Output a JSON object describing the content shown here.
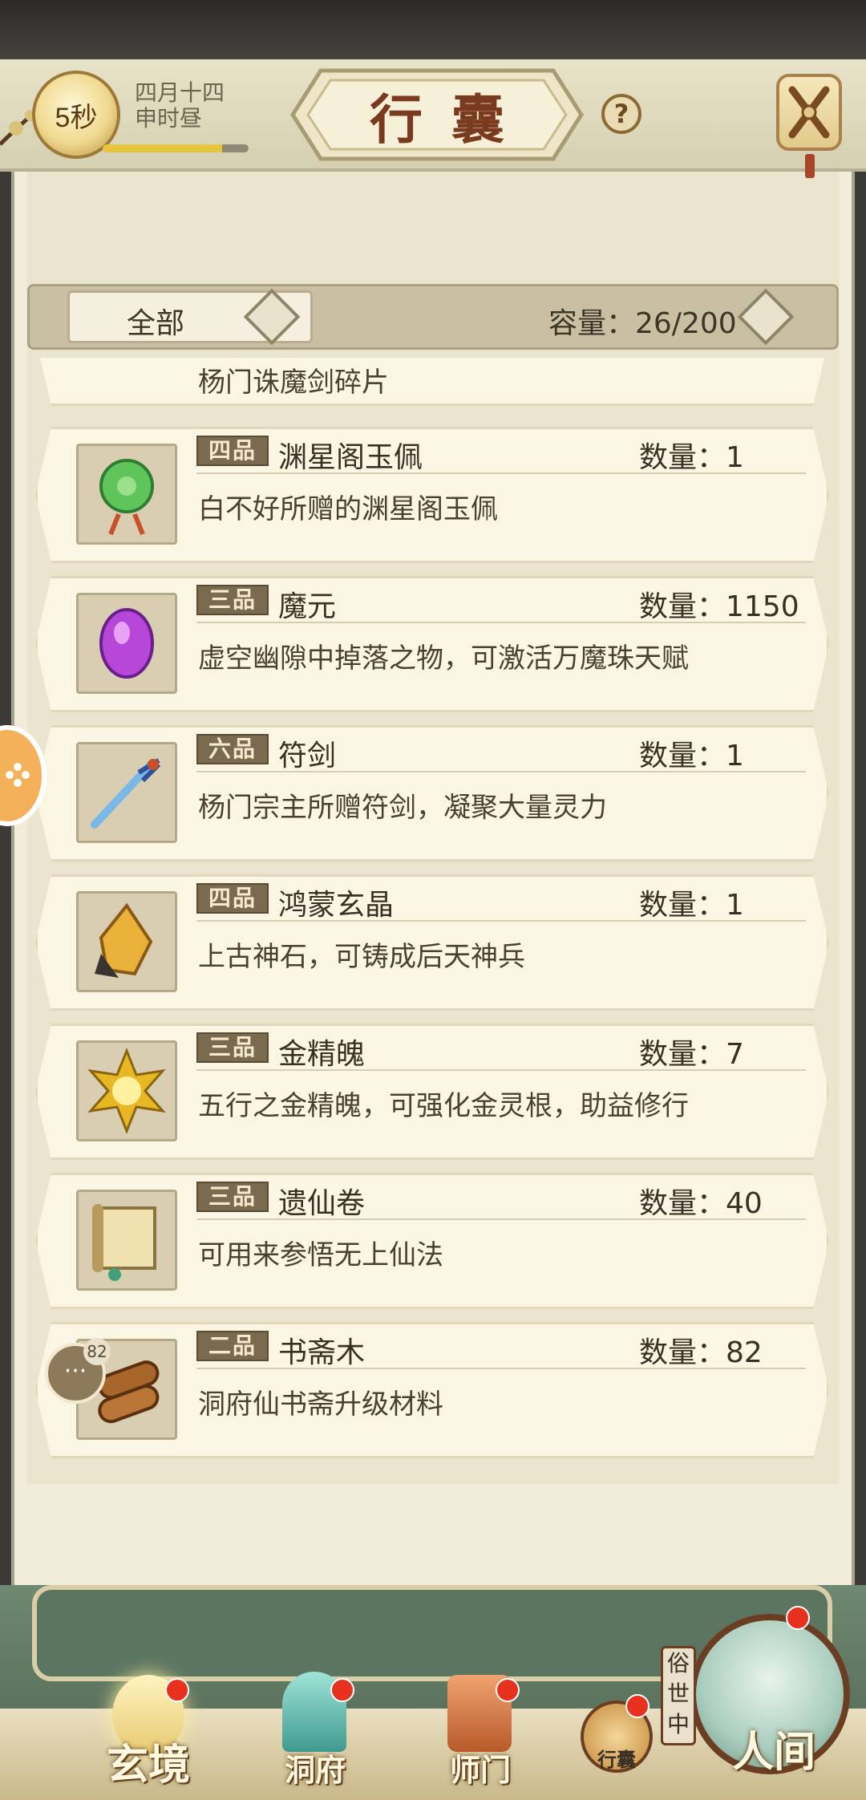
{
  "header": {
    "timer": "5秒",
    "date_line1": "四月十四",
    "date_line2": "申时昼",
    "time_progress": 0.82,
    "title": "行囊",
    "help": "?"
  },
  "filter": {
    "selected": "全部",
    "capacity": "容量：26/200"
  },
  "items": [
    {
      "grade": "",
      "name": "",
      "qty": "",
      "desc": "杨门诛魔剑碎片"
    },
    {
      "grade": "四品",
      "name": "渊星阁玉佩",
      "qty": "数量：1",
      "desc": "白不好所赠的渊星阁玉佩"
    },
    {
      "grade": "三品",
      "name": "魔元",
      "qty": "数量：1150",
      "desc": "虚空幽隙中掉落之物，可激活万魔珠天赋"
    },
    {
      "grade": "六品",
      "name": "符剑",
      "qty": "数量：1",
      "desc": "杨门宗主所赠符剑，凝聚大量灵力"
    },
    {
      "grade": "四品",
      "name": "鸿蒙玄晶",
      "qty": "数量：1",
      "desc": "上古神石，可铸成后天神兵"
    },
    {
      "grade": "三品",
      "name": "金精魄",
      "qty": "数量：7",
      "desc": "五行之金精魄，可强化金灵根，助益修行"
    },
    {
      "grade": "三品",
      "name": "遗仙卷",
      "qty": "数量：40",
      "desc": "可用来参悟无上仙法"
    },
    {
      "grade": "二品",
      "name": "书斋木",
      "qty": "数量：82",
      "desc": "洞府仙书斋升级材料"
    }
  ],
  "chat": {
    "count": "82"
  },
  "nav": {
    "xuanjing": "玄境",
    "dongfu": "洞府",
    "shimen": "师门",
    "xingnang": "行囊",
    "sushizhong": "俗世中",
    "renjian": "人间"
  }
}
